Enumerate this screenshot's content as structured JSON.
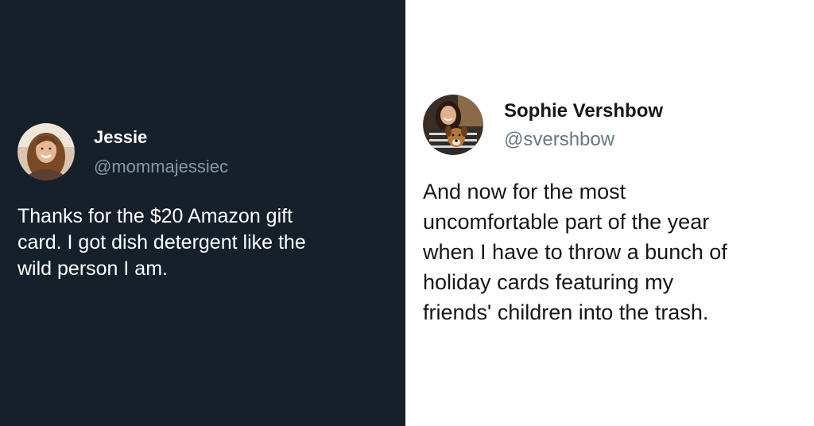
{
  "left_tweet": {
    "name": "Jessie",
    "handle": "@mommajessiec",
    "lines": [
      "Thanks for the $20 Amazon gift",
      "card. I got dish detergent like the",
      "wild person I am."
    ],
    "avatar_icon": "user-photo-avatar",
    "colors": {
      "background": "#15202b",
      "text": "#ffffff",
      "handle": "#8899a6"
    }
  },
  "right_tweet": {
    "name": "Sophie Vershbow",
    "handle": "@svershbow",
    "lines": [
      "And now for the most",
      "uncomfortable part of the year",
      "when I have to throw a bunch of",
      "holiday cards featuring my",
      "friends' children into the trash."
    ],
    "avatar_icon": "user-with-dog-photo-avatar",
    "colors": {
      "background": "#ffffff",
      "text": "#14171a",
      "handle": "#657786"
    }
  }
}
